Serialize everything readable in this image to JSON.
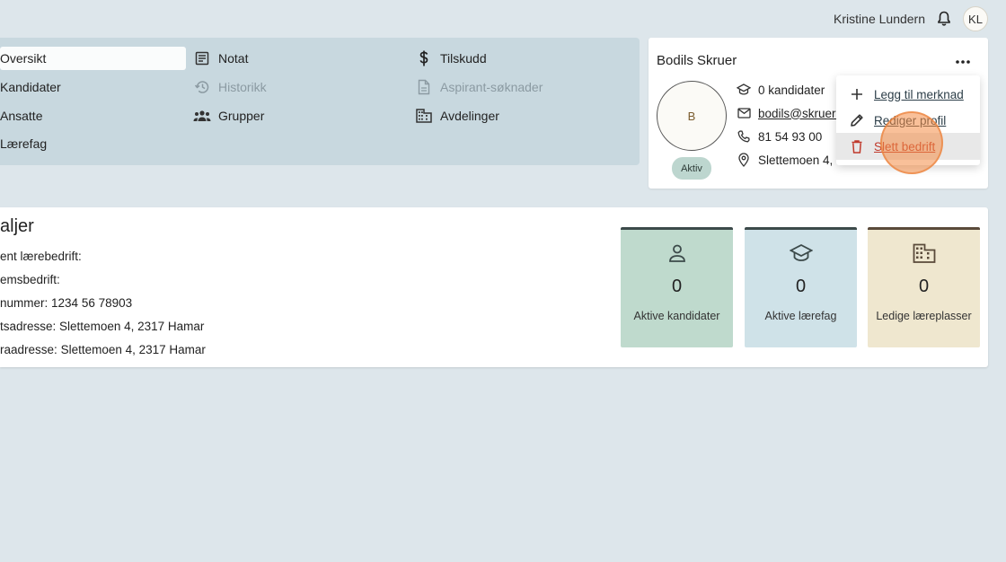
{
  "header": {
    "user_name": "Kristine Lundern",
    "user_initials": "KL"
  },
  "nav": {
    "items": [
      {
        "label": "Oversikt",
        "icon": "none",
        "state": "active"
      },
      {
        "label": "Kandidater",
        "icon": "none",
        "state": "normal"
      },
      {
        "label": "Ansatte",
        "icon": "none",
        "state": "normal"
      },
      {
        "label": "Lærefag",
        "icon": "none",
        "state": "normal"
      },
      {
        "label": "Notat",
        "icon": "note-icon",
        "state": "normal"
      },
      {
        "label": "Historikk",
        "icon": "history-icon",
        "state": "disabled"
      },
      {
        "label": "Grupper",
        "icon": "groups-icon",
        "state": "normal"
      },
      {
        "label": "Tilskudd",
        "icon": "dollar-icon",
        "state": "normal"
      },
      {
        "label": "Aspirant-søknader",
        "icon": "document-icon",
        "state": "disabled"
      },
      {
        "label": "Avdelinger",
        "icon": "building-icon",
        "state": "normal"
      }
    ]
  },
  "company": {
    "name": "Bodils Skruer",
    "logo_letter": "B",
    "status": "Aktiv",
    "candidates": "0 kandidater",
    "email": "bodils@skruer.",
    "phone": "81 54 93 00",
    "address": "Slettemoen 4,"
  },
  "menu": {
    "items": [
      {
        "label": "Legg til merknad",
        "icon": "plus-icon"
      },
      {
        "label": "Rediger profil",
        "icon": "pencil-icon"
      },
      {
        "label": "Slett bedrift",
        "icon": "trash-icon"
      }
    ]
  },
  "details": {
    "title": "aljer",
    "lines": [
      {
        "key": "ent lærebedrift:",
        "value": ""
      },
      {
        "key": "emsbedrift:",
        "value": ""
      },
      {
        "key": "nummer:",
        "value": "1234 56 78903"
      },
      {
        "key": "tsadresse:",
        "value": "Slettemoen 4, 2317 Hamar"
      },
      {
        "key": "raadresse:",
        "value": "Slettemoen 4, 2317 Hamar"
      }
    ]
  },
  "stats": [
    {
      "value": "0",
      "label": "Aktive kandidater",
      "bg": "#bfdacd",
      "icon": "person-icon"
    },
    {
      "value": "0",
      "label": "Aktive lærefag",
      "bg": "#cfe2e8",
      "icon": "graduation-cap-icon"
    },
    {
      "value": "0",
      "label": "Ledige læreplasser",
      "bg": "#efe7cf",
      "icon": "building-icon"
    }
  ],
  "colors": {
    "background": "#dde6eb",
    "nav_panel": "#c8d8df",
    "danger": "#c0392b",
    "status_badge": "#bdd6cf"
  }
}
